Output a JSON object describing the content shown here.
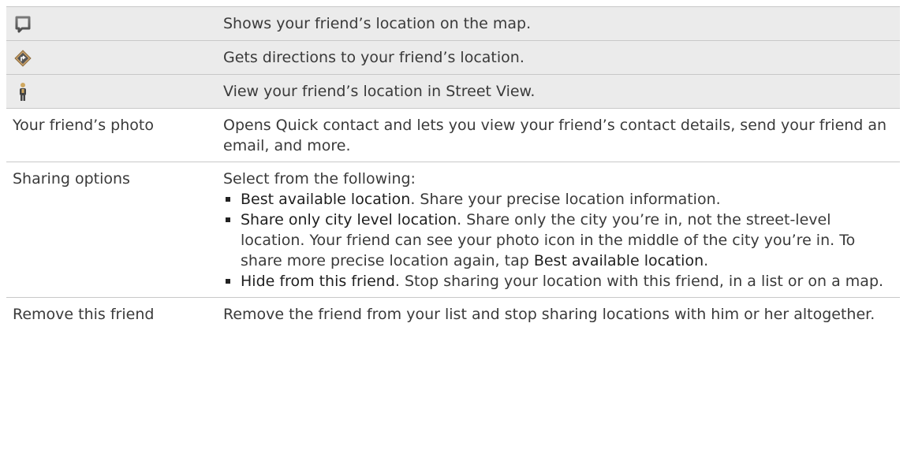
{
  "rows": [
    {
      "icon": "map-marker-icon",
      "description": "Shows your friend’s location on the map."
    },
    {
      "icon": "directions-icon",
      "description": "Gets directions to your friend’s location."
    },
    {
      "icon": "street-view-person-icon",
      "description": "View your friend’s location in Street View."
    }
  ],
  "photo_row": {
    "label": "Your friend’s photo",
    "description": "Opens Quick contact and lets you view your friend’s contact details, send your friend an email, and more."
  },
  "sharing_row": {
    "label": "Sharing options",
    "intro": "Select from the following:",
    "options": [
      {
        "term": "Best available location",
        "text": ". Share your precise location information."
      },
      {
        "term": "Share only city level location",
        "text": ". Share only the city you’re in, not the street-level location. Your friend can see your photo icon in the middle of the city you’re in. To share more precise location again, tap ",
        "tail_term": "Best available location",
        "tail_text": "."
      },
      {
        "term": "Hide from this friend",
        "text": ". Stop sharing your location with this friend, in a list or on a map."
      }
    ]
  },
  "remove_row": {
    "label": "Remove this friend",
    "description": "Remove the friend from your list and stop sharing locations with him or her altogether."
  },
  "colors": {
    "icon_row_bg": "#ebebeb",
    "border": "#c8c8c8",
    "text": "#3a3a3a"
  }
}
